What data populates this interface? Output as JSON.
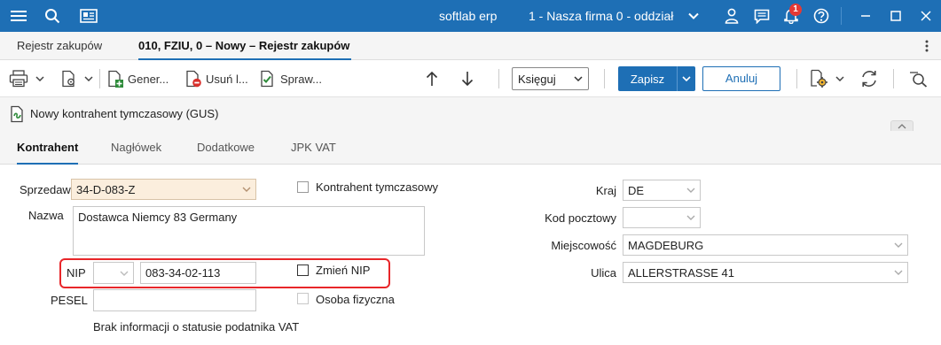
{
  "titlebar": {
    "app_name": "softlab erp",
    "company": "1 - Nasza firma 0 - oddział",
    "notification_count": "1"
  },
  "doc_tabs": [
    {
      "label": "Rejestr zakupów"
    },
    {
      "label": "010, FZIU, 0 – Nowy – Rejestr zakupów"
    }
  ],
  "toolbar": {
    "generate_label": "Gener...",
    "delete_label": "Usuń l...",
    "check_label": "Spraw...",
    "post_label": "Księguj",
    "save_label": "Zapisz",
    "cancel_label": "Anuluj"
  },
  "info": {
    "text": "Nowy kontrahent tymczasowy (GUS)"
  },
  "section_tabs": [
    {
      "label": "Kontrahent"
    },
    {
      "label": "Nagłówek"
    },
    {
      "label": "Dodatkowe"
    },
    {
      "label": "JPK VAT"
    }
  ],
  "form": {
    "seller_label": "Sprzedawca",
    "seller_value": "34-D-083-Z",
    "temp_contractor_label": "Kontrahent tymczasowy",
    "name_label": "Nazwa",
    "name_value": "Dostawca Niemcy 83 Germany",
    "nip_label": "NIP",
    "nip_prefix": "",
    "nip_value": "083-34-02-113",
    "change_nip_label": "Zmień NIP",
    "pesel_label": "PESEL",
    "pesel_value": "",
    "natural_person_label": "Osoba fizyczna",
    "vat_status_text": "Brak informacji o statusie podatnika VAT",
    "country_label": "Kraj",
    "country_value": "DE",
    "postal_label": "Kod pocztowy",
    "postal_value": "",
    "city_label": "Miejscowość",
    "city_value": "MAGDEBURG",
    "street_label": "Ulica",
    "street_value": "ALLERSTRASSE 41"
  },
  "colors": {
    "accent": "#1e6fb5",
    "highlight": "#e8262a",
    "seller_field_bg": "#fbeedd"
  }
}
